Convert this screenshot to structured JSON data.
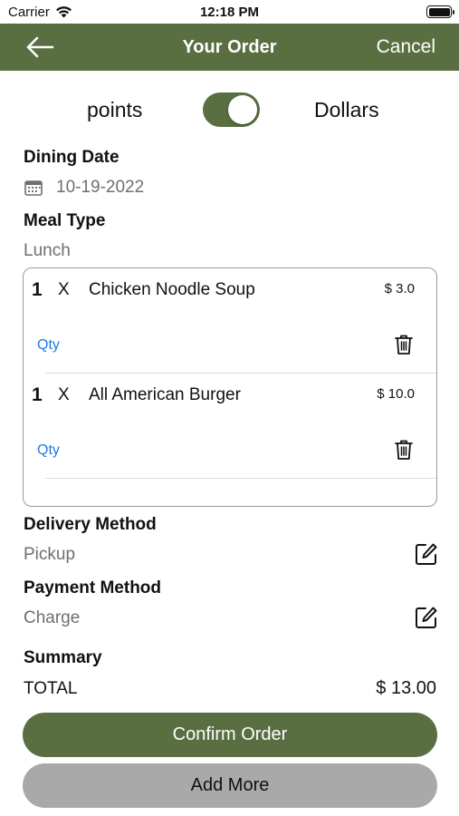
{
  "status_bar": {
    "carrier": "Carrier",
    "time": "12:18 PM"
  },
  "nav": {
    "title": "Your Order",
    "cancel_label": "Cancel",
    "background": "#596f42"
  },
  "currency_toggle": {
    "left_label": "points",
    "right_label": "Dollars",
    "is_on": true
  },
  "dining_date": {
    "heading": "Dining Date",
    "value": "10-19-2022"
  },
  "meal_type": {
    "heading": "Meal Type",
    "value": "Lunch"
  },
  "order_items": [
    {
      "qty": "1",
      "x": "X",
      "name": "Chicken Noodle Soup",
      "price": "$ 3.0",
      "qty_link": "Qty"
    },
    {
      "qty": "1",
      "x": "X",
      "name": "All American Burger",
      "price": "$ 10.0",
      "qty_link": "Qty"
    }
  ],
  "delivery": {
    "heading": "Delivery Method",
    "value": "Pickup"
  },
  "payment": {
    "heading": "Payment Method",
    "value": "Charge"
  },
  "summary": {
    "heading": "Summary",
    "total_label": "TOTAL",
    "total_value": "$ 13.00"
  },
  "buttons": {
    "confirm_label": "Confirm Order",
    "add_more_label": "Add More"
  },
  "colors": {
    "accent": "#596f42",
    "link": "#1e7be0",
    "secondary_button": "#a9a9a9"
  }
}
